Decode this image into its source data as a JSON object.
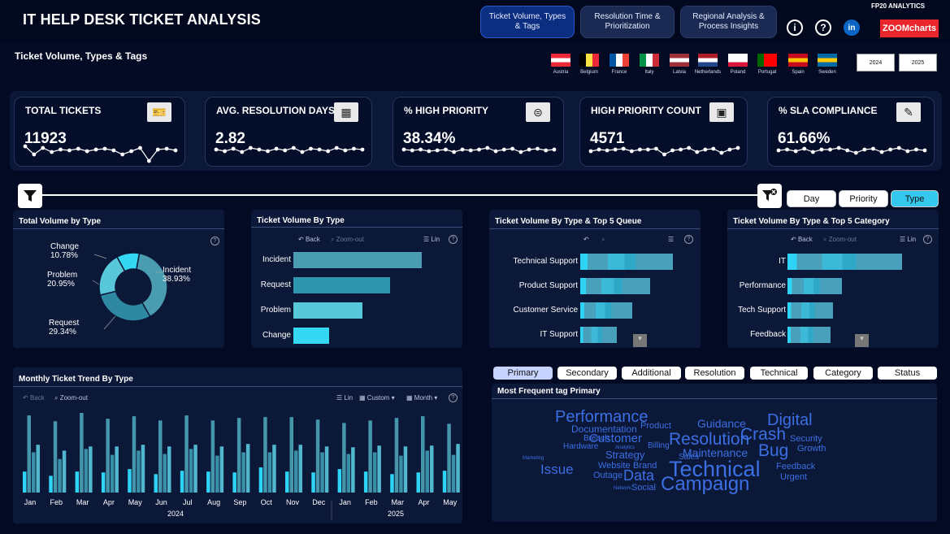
{
  "header": {
    "title": "IT HELP DESK TICKET ANALYSIS",
    "brand": "FP20 ANALYTICS",
    "zoomcharts": "ZOOMcharts",
    "nav": [
      {
        "label": "Ticket Volume, Types & Tags",
        "active": true
      },
      {
        "label": "Resolution Time & Prioritization",
        "active": false
      },
      {
        "label": "Regional Analysis & Process Insights",
        "active": false
      }
    ],
    "icons": [
      "info-icon",
      "help-icon",
      "linkedin-icon"
    ]
  },
  "section_title": "Ticket Volume, Types & Tags",
  "countries": [
    "Austria",
    "Belgium",
    "France",
    "Italy",
    "Latvia",
    "Netherlands",
    "Poland",
    "Portugal",
    "Spain",
    "Sweden"
  ],
  "years": [
    "2024",
    "2025"
  ],
  "kpis": [
    {
      "title": "TOTAL TICKETS",
      "value": "11923",
      "icon": "ticket-icon"
    },
    {
      "title": "AVG. RESOLUTION DAYS",
      "value": "2.82",
      "icon": "calendar-icon"
    },
    {
      "title": "% HIGH PRIORITY",
      "value": "38.34%",
      "icon": "priority-icon"
    },
    {
      "title": "HIGH PRIORITY COUNT",
      "value": "4571",
      "icon": "counter-icon"
    },
    {
      "title": "% SLA COMPLIANCE",
      "value": "61.66%",
      "icon": "document-check-icon"
    }
  ],
  "toggles": [
    {
      "label": "Day",
      "active": false
    },
    {
      "label": "Priority",
      "active": false
    },
    {
      "label": "Type",
      "active": true
    }
  ],
  "toolbar": {
    "back": "Back",
    "zoom": "Zoom-out",
    "lin": "Lin",
    "custom": "Custom",
    "month": "Month"
  },
  "donut": {
    "title": "Total Volume by Type",
    "labels": [
      {
        "name": "Incident",
        "pct": "38.93%"
      },
      {
        "name": "Request",
        "pct": "29.34%"
      },
      {
        "name": "Problem",
        "pct": "20.95%"
      },
      {
        "name": "Change",
        "pct": "10.78%"
      }
    ]
  },
  "chart_data": [
    {
      "type": "pie",
      "title": "Total Volume by Type",
      "categories": [
        "Incident",
        "Request",
        "Problem",
        "Change"
      ],
      "values": [
        38.93,
        29.34,
        20.95,
        10.78
      ],
      "colors": [
        "#4a9cb0",
        "#2f88a2",
        "#58c7d9",
        "#35d8f2"
      ]
    },
    {
      "type": "bar",
      "title": "Ticket Volume By Type",
      "categories": [
        "Incident",
        "Request",
        "Problem",
        "Change"
      ],
      "values": [
        4642,
        3498,
        2498,
        1285
      ]
    },
    {
      "type": "bar",
      "title": "Ticket Volume By Type & Top 5 Queue",
      "categories": [
        "Technical Support",
        "Product Support",
        "Customer Service",
        "IT Support"
      ],
      "values": [
        3300,
        2500,
        1850,
        1300
      ]
    },
    {
      "type": "bar",
      "title": "Ticket Volume By Type & Top 5 Category",
      "categories": [
        "IT",
        "Performance",
        "Tech Support",
        "Feedback"
      ],
      "values": [
        4000,
        1900,
        1600,
        1500
      ]
    },
    {
      "type": "bar",
      "title": "Monthly Ticket Trend By Type",
      "categories": [
        "Jan",
        "Feb",
        "Mar",
        "Apr",
        "May",
        "Jun",
        "Jul",
        "Aug",
        "Sep",
        "Oct",
        "Nov",
        "Dec",
        "Jan",
        "Feb",
        "Mar",
        "Apr",
        "May"
      ],
      "year_labels": [
        "2024",
        "2025"
      ],
      "series": [
        {
          "values": [
            25,
            20,
            25,
            24,
            28,
            22,
            26,
            25,
            24,
            30,
            25,
            24,
            28,
            25,
            22,
            24,
            26
          ]
        },
        {
          "values": [
            92,
            85,
            95,
            88,
            91,
            86,
            92,
            86,
            89,
            90,
            90,
            87,
            83,
            86,
            89,
            91,
            82
          ]
        },
        {
          "values": [
            48,
            40,
            52,
            45,
            50,
            46,
            52,
            44,
            48,
            48,
            50,
            48,
            46,
            48,
            44,
            50,
            45
          ]
        },
        {
          "values": [
            57,
            50,
            55,
            55,
            57,
            55,
            57,
            55,
            58,
            57,
            57,
            55,
            54,
            56,
            55,
            56,
            58
          ]
        }
      ]
    }
  ],
  "tags": {
    "buttons": [
      {
        "label": "Primary",
        "active": true
      },
      {
        "label": "Secondary",
        "active": false
      },
      {
        "label": "Additional",
        "active": false
      },
      {
        "label": "Resolution",
        "active": false
      },
      {
        "label": "Technical",
        "active": false
      },
      {
        "label": "Category",
        "active": false
      },
      {
        "label": "Status",
        "active": false
      }
    ],
    "title": "Most Frequent tag Primary",
    "cloud": [
      {
        "w": "Technical",
        "s": 27
      },
      {
        "w": "Campaign",
        "s": 24
      },
      {
        "w": "Resolution",
        "s": 21
      },
      {
        "w": "Performance",
        "s": 20
      },
      {
        "w": "Crash",
        "s": 21
      },
      {
        "w": "Bug",
        "s": 21
      },
      {
        "w": "Digital",
        "s": 20
      },
      {
        "w": "Data",
        "s": 18
      },
      {
        "w": "Issue",
        "s": 17
      },
      {
        "w": "Customer",
        "s": 15
      },
      {
        "w": "Guidance",
        "s": 14
      },
      {
        "w": "Maintenance",
        "s": 14
      },
      {
        "w": "Strategy",
        "s": 13
      },
      {
        "w": "Documentation",
        "s": 12
      },
      {
        "w": "Product",
        "s": 11
      },
      {
        "w": "Website",
        "s": 11
      },
      {
        "w": "Brand",
        "s": 11
      },
      {
        "w": "Breach",
        "s": 10
      },
      {
        "w": "Outage",
        "s": 11
      },
      {
        "w": "Social",
        "s": 11
      },
      {
        "w": "Urgent",
        "s": 11
      },
      {
        "w": "Feedback",
        "s": 11
      },
      {
        "w": "Security",
        "s": 11
      },
      {
        "w": "Growth",
        "s": 11
      },
      {
        "w": "Hardware",
        "s": 10
      },
      {
        "w": "Billing",
        "s": 10
      },
      {
        "w": "Sales",
        "s": 10
      },
      {
        "w": "Network",
        "s": 6
      },
      {
        "w": "Analytics",
        "s": 6
      },
      {
        "w": "Marketing",
        "s": 6
      }
    ]
  }
}
